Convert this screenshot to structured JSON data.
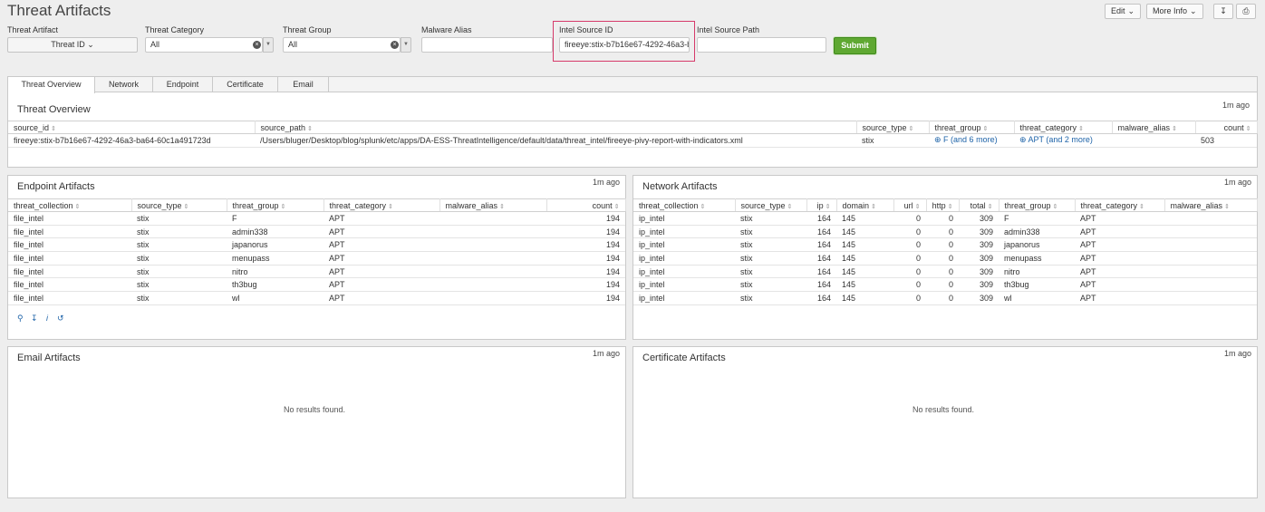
{
  "page_title": "Threat Artifacts",
  "top_buttons": {
    "edit": "Edit",
    "more_info": "More Info",
    "export_icon": "download-icon",
    "print_icon": "print-icon"
  },
  "filters": {
    "threat_artifact": {
      "label": "Threat Artifact",
      "value": "Threat ID"
    },
    "threat_category": {
      "label": "Threat Category",
      "value": "All"
    },
    "threat_group": {
      "label": "Threat Group",
      "value": "All"
    },
    "malware_alias": {
      "label": "Malware Alias",
      "value": ""
    },
    "intel_source_id": {
      "label": "Intel Source ID",
      "value": "fireeye:stix-b7b16e67-4292-46a3-b"
    },
    "intel_source_path": {
      "label": "Intel Source Path",
      "value": ""
    },
    "submit": "Submit"
  },
  "tabs": [
    "Threat Overview",
    "Network",
    "Endpoint",
    "Certificate",
    "Email"
  ],
  "overview": {
    "title": "Threat Overview",
    "ago": "1m ago",
    "columns": [
      "source_id",
      "source_path",
      "source_type",
      "threat_group",
      "threat_category",
      "malware_alias",
      "count"
    ],
    "row": {
      "source_id": "fireeye:stix-b7b16e67-4292-46a3-ba64-60c1a491723d",
      "source_path": "/Users/bluger/Desktop/blog/splunk/etc/apps/DA-ESS-ThreatIntelligence/default/data/threat_intel/fireeye-pivy-report-with-indicators.xml",
      "source_type": "stix",
      "threat_group": "F (and 6 more)",
      "threat_category": "APT (and 2 more)",
      "malware_alias": "",
      "count": "503"
    }
  },
  "endpoint": {
    "title": "Endpoint Artifacts",
    "ago": "1m ago",
    "columns": [
      "threat_collection",
      "source_type",
      "threat_group",
      "threat_category",
      "malware_alias",
      "count"
    ],
    "rows": [
      [
        "file_intel",
        "stix",
        "F",
        "APT",
        "",
        "194"
      ],
      [
        "file_intel",
        "stix",
        "admin338",
        "APT",
        "",
        "194"
      ],
      [
        "file_intel",
        "stix",
        "japanorus",
        "APT",
        "",
        "194"
      ],
      [
        "file_intel",
        "stix",
        "menupass",
        "APT",
        "",
        "194"
      ],
      [
        "file_intel",
        "stix",
        "nitro",
        "APT",
        "",
        "194"
      ],
      [
        "file_intel",
        "stix",
        "th3bug",
        "APT",
        "",
        "194"
      ],
      [
        "file_intel",
        "stix",
        "wl",
        "APT",
        "",
        "194"
      ]
    ]
  },
  "network": {
    "title": "Network Artifacts",
    "ago": "1m ago",
    "columns": [
      "threat_collection",
      "source_type",
      "ip",
      "domain",
      "url",
      "http",
      "total",
      "threat_group",
      "threat_category",
      "malware_alias"
    ],
    "rows": [
      [
        "ip_intel",
        "stix",
        "164",
        "145",
        "0",
        "0",
        "309",
        "F",
        "APT",
        ""
      ],
      [
        "ip_intel",
        "stix",
        "164",
        "145",
        "0",
        "0",
        "309",
        "admin338",
        "APT",
        ""
      ],
      [
        "ip_intel",
        "stix",
        "164",
        "145",
        "0",
        "0",
        "309",
        "japanorus",
        "APT",
        ""
      ],
      [
        "ip_intel",
        "stix",
        "164",
        "145",
        "0",
        "0",
        "309",
        "menupass",
        "APT",
        ""
      ],
      [
        "ip_intel",
        "stix",
        "164",
        "145",
        "0",
        "0",
        "309",
        "nitro",
        "APT",
        ""
      ],
      [
        "ip_intel",
        "stix",
        "164",
        "145",
        "0",
        "0",
        "309",
        "th3bug",
        "APT",
        ""
      ],
      [
        "ip_intel",
        "stix",
        "164",
        "145",
        "0",
        "0",
        "309",
        "wl",
        "APT",
        ""
      ]
    ]
  },
  "email": {
    "title": "Email Artifacts",
    "ago": "1m ago",
    "empty": "No results found."
  },
  "certificate": {
    "title": "Certificate Artifacts",
    "ago": "1m ago",
    "empty": "No results found."
  }
}
